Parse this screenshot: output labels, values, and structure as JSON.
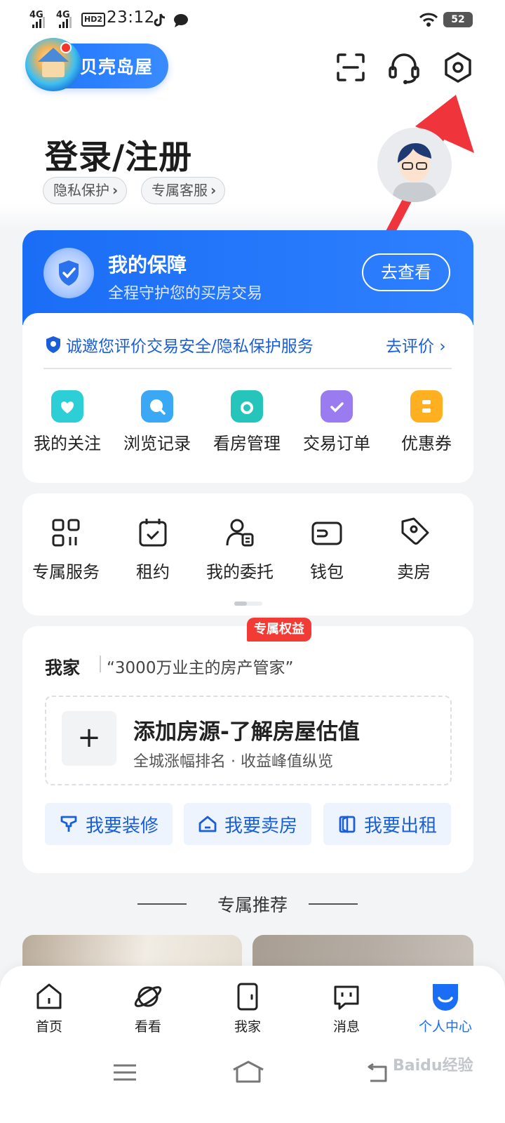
{
  "status_bar": {
    "net1": "4G",
    "net2": "4G",
    "hd": "HD2",
    "time": "23:12",
    "battery": "52"
  },
  "header": {
    "logo_text": "贝壳岛屋",
    "icons": [
      "scan-icon",
      "headset-icon",
      "settings-icon"
    ]
  },
  "user": {
    "login_text": "登录/注册",
    "privacy_label": "隐私保护",
    "service_label": "专属客服"
  },
  "guarantee": {
    "title": "我的保障",
    "subtitle": "全程守护您的买房交易",
    "button": "去查看",
    "invite_text": "诚邀您评价交易安全/隐私保护服务",
    "rate_link": "去评价"
  },
  "quick_links": [
    {
      "label": "我的关注",
      "icon": "heart-icon",
      "color": "#2ccfd6"
    },
    {
      "label": "浏览记录",
      "icon": "search-icon",
      "color": "#3aa8f5"
    },
    {
      "label": "看房管理",
      "icon": "folder-icon",
      "color": "#25c5bc"
    },
    {
      "label": "交易订单",
      "icon": "clipboard-icon",
      "color": "#9b7cf0"
    },
    {
      "label": "优惠券",
      "icon": "coupon-icon",
      "color": "#ffb020"
    }
  ],
  "services": [
    {
      "label": "专属服务",
      "icon": "grid-icon"
    },
    {
      "label": "租约",
      "icon": "calendar-check-icon"
    },
    {
      "label": "我的委托",
      "icon": "person-doc-icon"
    },
    {
      "label": "钱包",
      "icon": "wallet-icon"
    },
    {
      "label": "卖房",
      "icon": "tag-icon"
    }
  ],
  "my_home": {
    "title": "我家",
    "subtitle": "“3000万业主的房产管家”",
    "add_title": "添加房源-了解房屋估值",
    "add_subtitle": "全城涨幅排名 · 收益峰值纵览",
    "plus": "+",
    "buttons": [
      {
        "label": "我要装修"
      },
      {
        "label": "我要卖房",
        "badge": "专属权益"
      },
      {
        "label": "我要出租"
      }
    ]
  },
  "recommend_title": "专属推荐",
  "tabs": [
    {
      "label": "首页",
      "icon": "home-icon"
    },
    {
      "label": "看看",
      "icon": "planet-icon"
    },
    {
      "label": "我家",
      "icon": "door-icon"
    },
    {
      "label": "消息",
      "icon": "message-icon"
    },
    {
      "label": "个人中心",
      "icon": "profile-face-icon",
      "active": true
    }
  ],
  "watermark": "Baidu经验",
  "accent_color": "#1a6ef5"
}
